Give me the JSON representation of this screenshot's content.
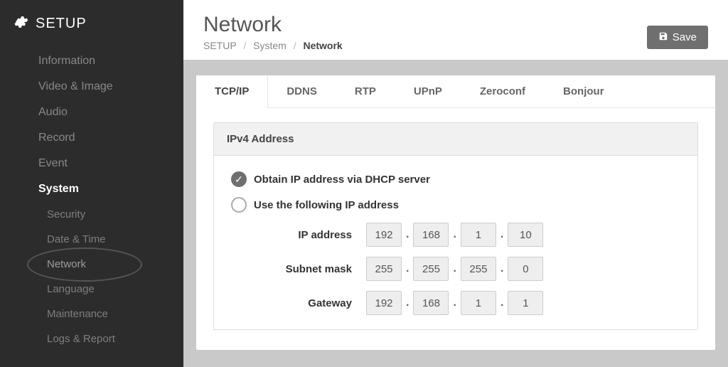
{
  "sidebar": {
    "title": "SETUP",
    "items": [
      {
        "label": "Information"
      },
      {
        "label": "Video & Image"
      },
      {
        "label": "Audio"
      },
      {
        "label": "Record"
      },
      {
        "label": "Event"
      },
      {
        "label": "System",
        "active": true
      },
      {
        "label": "Security",
        "sub": true
      },
      {
        "label": "Date & Time",
        "sub": true
      },
      {
        "label": "Network",
        "sub": true,
        "current": true
      },
      {
        "label": "Language",
        "sub": true
      },
      {
        "label": "Maintenance",
        "sub": true
      },
      {
        "label": "Logs & Report",
        "sub": true
      }
    ]
  },
  "header": {
    "title": "Network",
    "breadcrumb": [
      "SETUP",
      "System",
      "Network"
    ],
    "save_label": "Save"
  },
  "tabs": [
    "TCP/IP",
    "DDNS",
    "RTP",
    "UPnP",
    "Zeroconf",
    "Bonjour"
  ],
  "active_tab": 0,
  "ipv4": {
    "section_title": "IPv4 Address",
    "radio_dhcp": "Obtain IP address via DHCP server",
    "radio_static": "Use the following IP address",
    "selected": "dhcp",
    "rows": [
      {
        "label": "IP address",
        "octets": [
          "192",
          "168",
          "1",
          "10"
        ]
      },
      {
        "label": "Subnet mask",
        "octets": [
          "255",
          "255",
          "255",
          "0"
        ]
      },
      {
        "label": "Gateway",
        "octets": [
          "192",
          "168",
          "1",
          "1"
        ]
      }
    ]
  }
}
